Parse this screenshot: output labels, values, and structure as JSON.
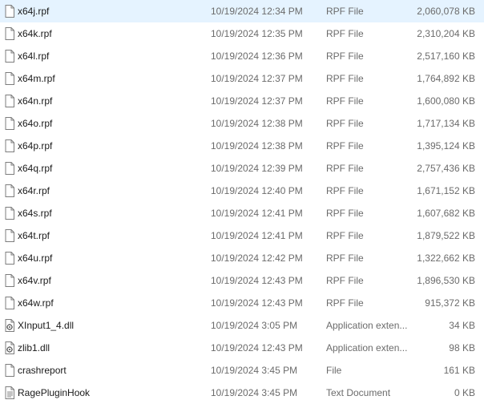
{
  "files": [
    {
      "name": "x64j.rpf",
      "date": "10/19/2024 12:34 PM",
      "type": "RPF File",
      "size": "2,060,078 KB",
      "icon": "file-icon",
      "selected": true
    },
    {
      "name": "x64k.rpf",
      "date": "10/19/2024 12:35 PM",
      "type": "RPF File",
      "size": "2,310,204 KB",
      "icon": "file-icon"
    },
    {
      "name": "x64l.rpf",
      "date": "10/19/2024 12:36 PM",
      "type": "RPF File",
      "size": "2,517,160 KB",
      "icon": "file-icon"
    },
    {
      "name": "x64m.rpf",
      "date": "10/19/2024 12:37 PM",
      "type": "RPF File",
      "size": "1,764,892 KB",
      "icon": "file-icon"
    },
    {
      "name": "x64n.rpf",
      "date": "10/19/2024 12:37 PM",
      "type": "RPF File",
      "size": "1,600,080 KB",
      "icon": "file-icon"
    },
    {
      "name": "x64o.rpf",
      "date": "10/19/2024 12:38 PM",
      "type": "RPF File",
      "size": "1,717,134 KB",
      "icon": "file-icon"
    },
    {
      "name": "x64p.rpf",
      "date": "10/19/2024 12:38 PM",
      "type": "RPF File",
      "size": "1,395,124 KB",
      "icon": "file-icon"
    },
    {
      "name": "x64q.rpf",
      "date": "10/19/2024 12:39 PM",
      "type": "RPF File",
      "size": "2,757,436 KB",
      "icon": "file-icon"
    },
    {
      "name": "x64r.rpf",
      "date": "10/19/2024 12:40 PM",
      "type": "RPF File",
      "size": "1,671,152 KB",
      "icon": "file-icon"
    },
    {
      "name": "x64s.rpf",
      "date": "10/19/2024 12:41 PM",
      "type": "RPF File",
      "size": "1,607,682 KB",
      "icon": "file-icon"
    },
    {
      "name": "x64t.rpf",
      "date": "10/19/2024 12:41 PM",
      "type": "RPF File",
      "size": "1,879,522 KB",
      "icon": "file-icon"
    },
    {
      "name": "x64u.rpf",
      "date": "10/19/2024 12:42 PM",
      "type": "RPF File",
      "size": "1,322,662 KB",
      "icon": "file-icon"
    },
    {
      "name": "x64v.rpf",
      "date": "10/19/2024 12:43 PM",
      "type": "RPF File",
      "size": "1,896,530 KB",
      "icon": "file-icon"
    },
    {
      "name": "x64w.rpf",
      "date": "10/19/2024 12:43 PM",
      "type": "RPF File",
      "size": "915,372 KB",
      "icon": "file-icon"
    },
    {
      "name": "XInput1_4.dll",
      "date": "10/19/2024 3:05 PM",
      "type": "Application exten...",
      "size": "34 KB",
      "icon": "dll-gear-icon"
    },
    {
      "name": "zlib1.dll",
      "date": "10/19/2024 12:43 PM",
      "type": "Application exten...",
      "size": "98 KB",
      "icon": "dll-gear-icon"
    },
    {
      "name": "crashreport",
      "date": "10/19/2024 3:45 PM",
      "type": "File",
      "size": "161 KB",
      "icon": "file-icon"
    },
    {
      "name": "RagePluginHook",
      "date": "10/19/2024 3:45 PM",
      "type": "Text Document",
      "size": "0 KB",
      "icon": "text-document-icon"
    }
  ]
}
